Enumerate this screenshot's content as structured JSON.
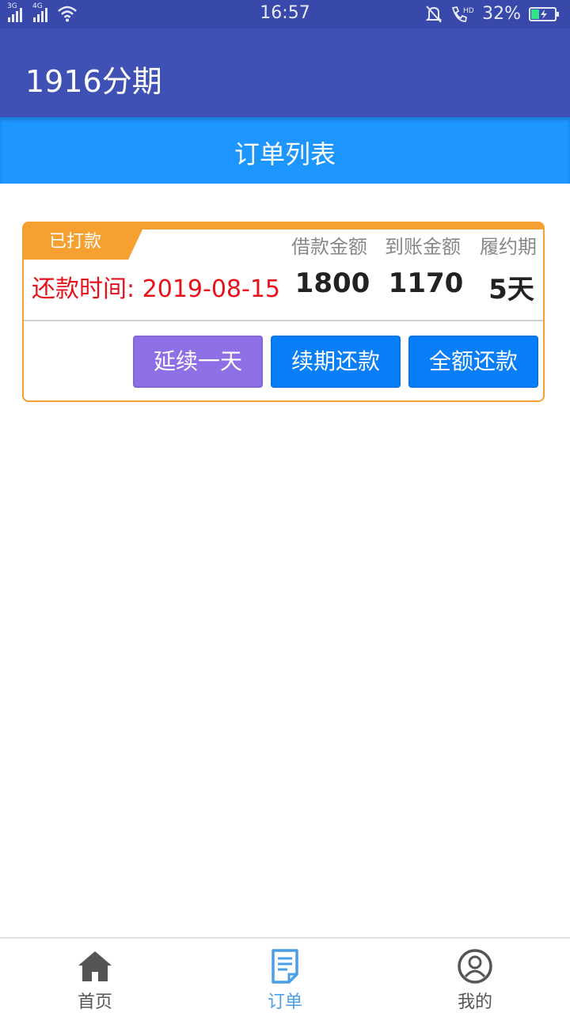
{
  "status_bar": {
    "network_1": "3G",
    "network_2": "4G",
    "time": "16:57",
    "battery_percent": "32%",
    "icons": [
      "signal-3g-icon",
      "signal-4g-icon",
      "wifi-icon",
      "mute-bell-icon",
      "hd-call-icon",
      "battery-charging-icon"
    ]
  },
  "app_bar": {
    "title": "1916分期"
  },
  "header": {
    "title": "订单列表"
  },
  "order": {
    "status_tag": "已打款",
    "columns": [
      "借款金额",
      "到账金额",
      "履约期"
    ],
    "repay_time_label": "还款时间: 2019-08-15",
    "loan_amount": "1800",
    "received_amount": "1170",
    "term": "5天",
    "buttons": {
      "extend": "延续一天",
      "renew": "续期还款",
      "full": "全额还款"
    }
  },
  "bottom_nav": {
    "items": [
      {
        "label": "首页",
        "icon": "home-icon",
        "active": false
      },
      {
        "label": "订单",
        "icon": "order-list-icon",
        "active": true
      },
      {
        "label": "我的",
        "icon": "profile-icon",
        "active": false
      }
    ]
  },
  "colors": {
    "status_bar": "#3949ab",
    "app_bar": "#3f51b5",
    "header": "#1e96ff",
    "card_border": "#f5a030",
    "repay_time": "#e8101a",
    "btn_extend": "#8f6fe6",
    "btn_primary": "#087ef8",
    "nav_active": "#4a9fe8",
    "nav_inactive": "#555555"
  }
}
